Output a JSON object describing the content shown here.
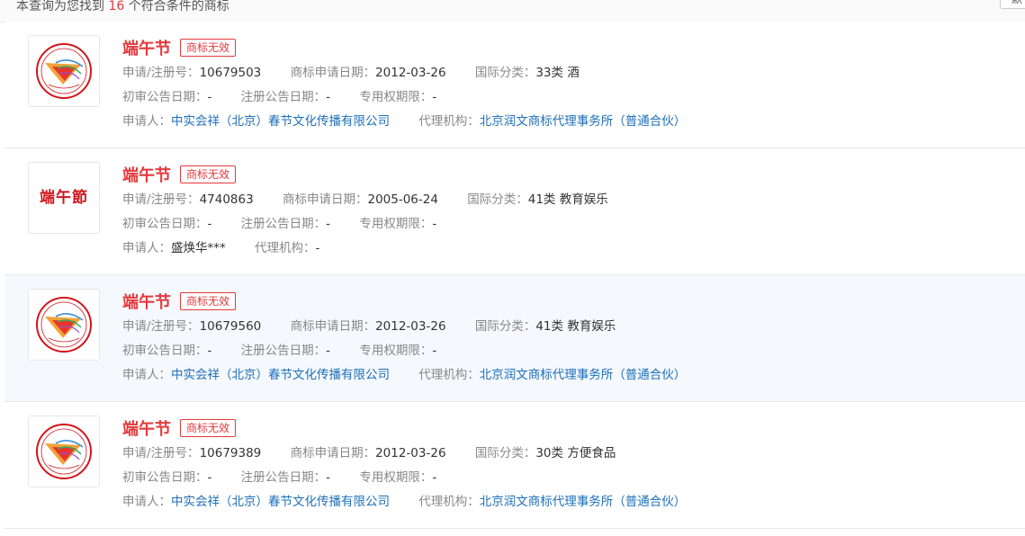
{
  "summary": {
    "prefix": "本查询为您找到",
    "count": "16",
    "suffix": "个符合条件的商标",
    "right_button": "默"
  },
  "labels": {
    "reg_no": "申请/注册号：",
    "app_date": "商标申请日期：",
    "intl_class": "国际分类：",
    "prelim_date": "初审公告日期：",
    "reg_date": "注册公告日期：",
    "exclusive": "专用权期限：",
    "applicant": "申请人：",
    "agency": "代理机构："
  },
  "items": [
    {
      "name": "端午节",
      "status": "商标无效",
      "reg_no": "10679503",
      "app_date": "2012-03-26",
      "intl_class": "33类 酒",
      "prelim_date": "-",
      "reg_date": "-",
      "exclusive": "-",
      "applicant": "中实会祥（北京）春节文化传播有限公司",
      "agency": "北京润文商标代理事务所（普通合伙）",
      "logo": "festival-seal-logo"
    },
    {
      "name": "端午节",
      "status": "商标无效",
      "reg_no": "4740863",
      "app_date": "2005-06-24",
      "intl_class": "41类 教育娱乐",
      "prelim_date": "-",
      "reg_date": "-",
      "exclusive": "-",
      "applicant": "盛焕华***",
      "agency": "-",
      "logo_text": "端午節"
    },
    {
      "name": "端午节",
      "status": "商标无效",
      "reg_no": "10679560",
      "app_date": "2012-03-26",
      "intl_class": "41类 教育娱乐",
      "prelim_date": "-",
      "reg_date": "-",
      "exclusive": "-",
      "applicant": "中实会祥（北京）春节文化传播有限公司",
      "agency": "北京润文商标代理事务所（普通合伙）",
      "logo": "festival-seal-logo"
    },
    {
      "name": "端午节",
      "status": "商标无效",
      "reg_no": "10679389",
      "app_date": "2012-03-26",
      "intl_class": "30类 方便食品",
      "prelim_date": "-",
      "reg_date": "-",
      "exclusive": "-",
      "applicant": "中实会祥（北京）春节文化传播有限公司",
      "agency": "北京润文商标代理事务所（普通合伙）",
      "logo": "festival-seal-logo"
    }
  ],
  "colors": {
    "accent": "#e4393c",
    "link": "#1e6fb8",
    "hover_row": "#f5f8fd"
  }
}
